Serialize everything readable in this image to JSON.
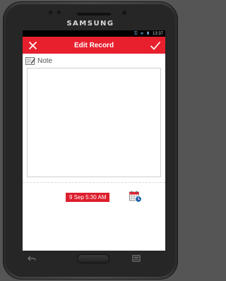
{
  "device": {
    "brand": "SAMSUNG"
  },
  "statusbar": {
    "time": "13:37",
    "icons": "⚿ ᯤ ▮"
  },
  "appbar": {
    "title": "Edit Record",
    "close_icon": "close-icon",
    "confirm_icon": "check-icon",
    "background": "#e8202e"
  },
  "note": {
    "label": "Note",
    "value": ""
  },
  "record": {
    "datetime": "9 Sep 5:30 AM"
  },
  "colors": {
    "accent": "#e8202e",
    "date_badge": "#dd1e2d"
  }
}
